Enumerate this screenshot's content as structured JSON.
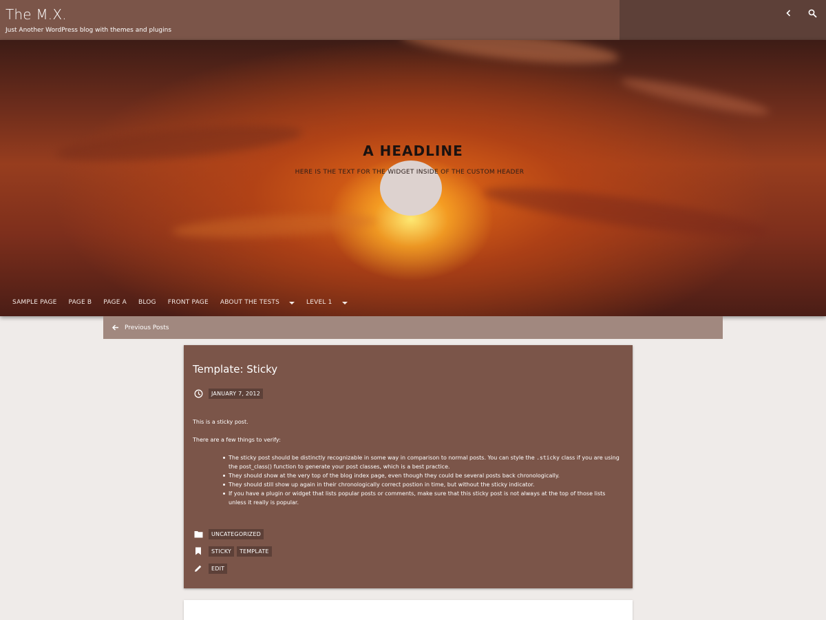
{
  "site": {
    "title": "The M.X.",
    "tagline": "Just Another WordPress blog with themes and plugins"
  },
  "header_icons": {
    "back": "chevron-left-icon",
    "search": "search-icon"
  },
  "hero": {
    "headline": "A HEADLINE",
    "widget_text": "HERE IS THE TEXT FOR THE WIDGET INSIDE OF THE CUSTOM HEADER"
  },
  "nav": {
    "items": [
      {
        "label": "SAMPLE PAGE"
      },
      {
        "label": "PAGE B"
      },
      {
        "label": "PAGE A"
      },
      {
        "label": "BLOG"
      },
      {
        "label": "FRONT PAGE"
      },
      {
        "label": "ABOUT THE TESTS"
      },
      {
        "label": "LEVEL 1"
      }
    ]
  },
  "pagination": {
    "previous_label": "Previous Posts"
  },
  "post": {
    "title": "Template: Sticky",
    "date": "JANUARY 7, 2012",
    "intro": "This is a sticky post.",
    "verify": "There are a few things to verify:",
    "bullet1_a": "The sticky post should be distinctly recognizable in some way in comparison to normal posts. You can style the ",
    "bullet1_code": ".sticky",
    "bullet1_b": " class if you are using the post_class() function to generate your post classes, which is a best practice.",
    "bullet2": "They should show at the very top of the blog index page, even though they could be several posts back chronologically.",
    "bullet3": "They should still show up again in their chronologically correct postion in time, but without the sticky indicator.",
    "bullet4": "If you have a plugin or widget that lists popular posts or comments, make sure that this sticky post is not always at the top of those lists unless it really is popular.",
    "category": "UNCATEGORIZED",
    "tags": [
      "STICKY",
      "TEMPLATE"
    ],
    "edit_label": "EDIT"
  },
  "colors": {
    "topbar": "#7b5549",
    "topbar_right": "#5d4038",
    "card": "#7b5549",
    "chip": "#5d4038",
    "prev_bar": "#a1887f",
    "background": "#efebe9"
  }
}
